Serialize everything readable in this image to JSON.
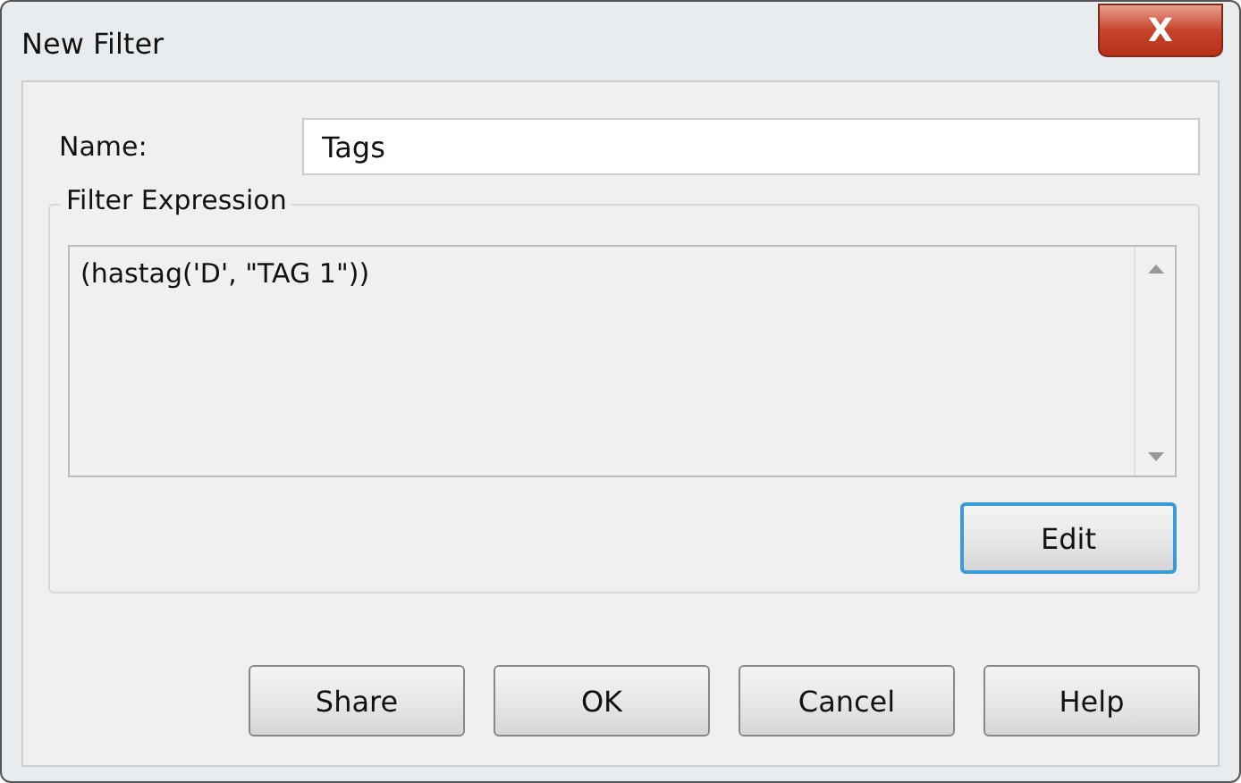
{
  "window": {
    "title": "New Filter",
    "close_icon": "X"
  },
  "name_field": {
    "label": "Name:",
    "value": "Tags"
  },
  "filter_expression": {
    "title": "Filter Expression",
    "value": "(hastag('D', \"TAG 1\"))",
    "edit_button": {
      "label": "Edit",
      "focused": true
    }
  },
  "buttons": [
    {
      "label": "Share",
      "focused": false
    },
    {
      "label": "OK",
      "focused": false
    },
    {
      "label": "Cancel",
      "focused": false
    },
    {
      "label": "Help",
      "focused": false
    }
  ]
}
